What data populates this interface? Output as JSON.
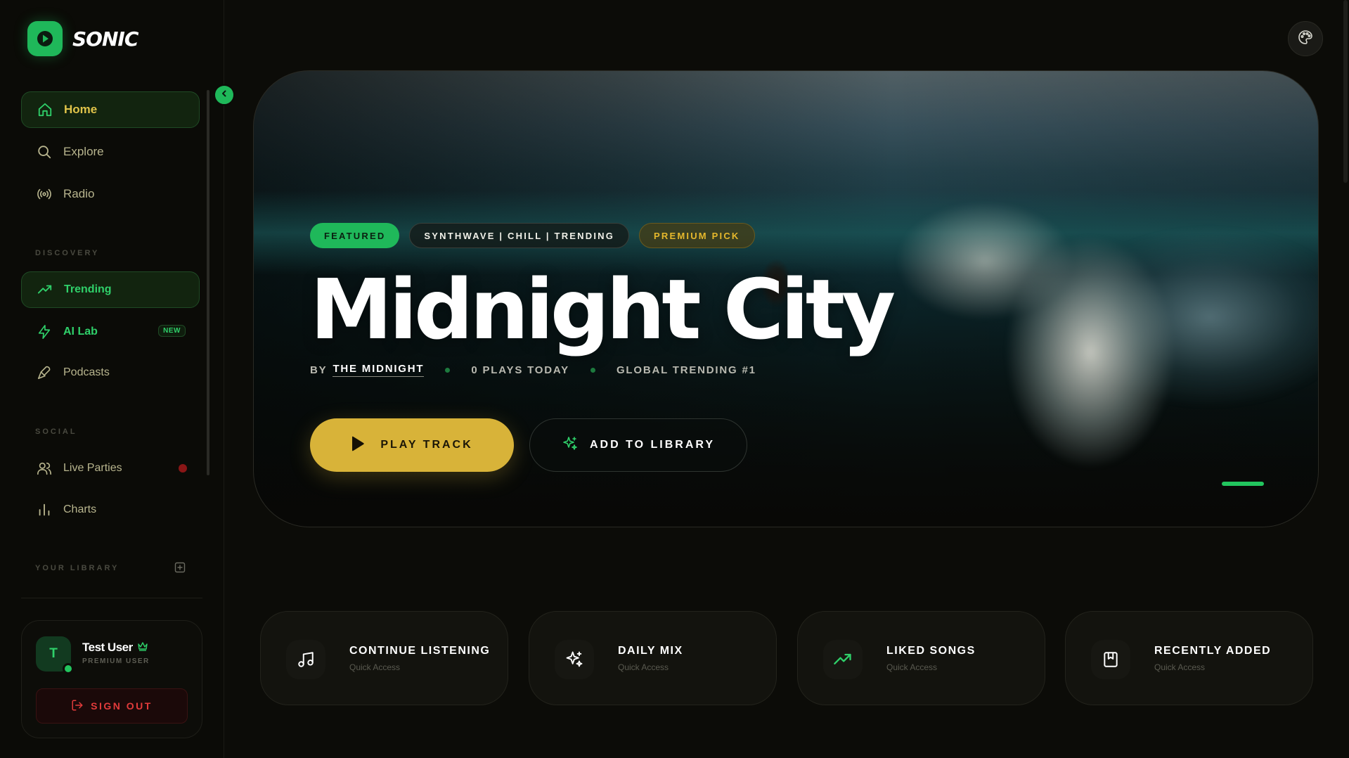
{
  "brand": {
    "name": "SONIC"
  },
  "nav": {
    "main": [
      {
        "label": "Home",
        "icon": "home-icon"
      },
      {
        "label": "Explore",
        "icon": "search-icon"
      },
      {
        "label": "Radio",
        "icon": "radio-icon"
      }
    ],
    "discovery_label": "DISCOVERY",
    "discovery": [
      {
        "label": "Trending",
        "icon": "trending-icon"
      },
      {
        "label": "AI Lab",
        "icon": "lightning-icon",
        "badge": "NEW"
      },
      {
        "label": "Podcasts",
        "icon": "microphone-icon"
      }
    ],
    "social_label": "SOCIAL",
    "social": [
      {
        "label": "Live Parties",
        "icon": "users-icon"
      },
      {
        "label": "Charts",
        "icon": "bar-chart-icon"
      }
    ],
    "library_label": "YOUR LIBRARY"
  },
  "user": {
    "initial": "T",
    "name": "Test User",
    "role": "PREMIUM USER",
    "signout_label": "SIGN OUT"
  },
  "hero": {
    "tags": {
      "featured": "FEATURED",
      "genres": "SYNTHWAVE | CHILL | TRENDING",
      "premium": "PREMIUM PICK"
    },
    "title": "Midnight City",
    "by_label": "BY",
    "artist": "THE MIDNIGHT",
    "plays": "0 PLAYS TODAY",
    "rank": "GLOBAL TRENDING #1",
    "play_label": "PLAY TRACK",
    "library_label": "ADD TO LIBRARY"
  },
  "quick_access": [
    {
      "title": "CONTINUE LISTENING",
      "subtitle": "Quick Access",
      "icon": "music-note-icon"
    },
    {
      "title": "DAILY MIX",
      "subtitle": "Quick Access",
      "icon": "sparkles-icon"
    },
    {
      "title": "LIKED SONGS",
      "subtitle": "Quick Access",
      "icon": "trending-up-icon"
    },
    {
      "title": "RECENTLY ADDED",
      "subtitle": "Quick Access",
      "icon": "bookmark-icon"
    }
  ],
  "colors": {
    "accent_green": "#1fb85a",
    "accent_gold": "#d8b339",
    "danger": "#e23b3b",
    "background": "#0c0c08"
  }
}
